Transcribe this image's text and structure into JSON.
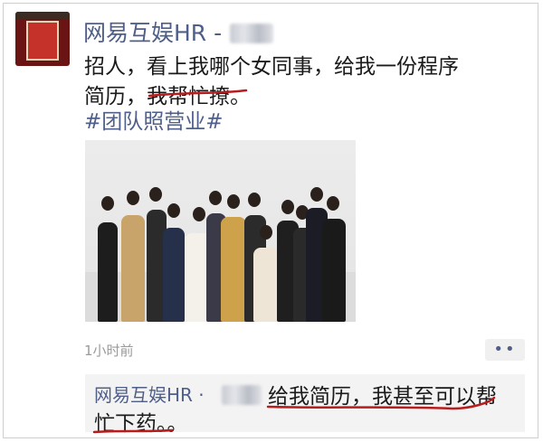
{
  "author": {
    "name": "网易互娱HR -"
  },
  "post": {
    "line1": "招人，看上我哪个女同事，给我一份程序",
    "line2": "简历，我帮忙撩。",
    "hashtag": "#团队照营业#"
  },
  "meta": {
    "time": "1小时前",
    "more": "••"
  },
  "comment": {
    "author": "网易互娱HR ·",
    "text_line1": "给我简历，我甚至可以帮",
    "text_line2": "忙下药。。"
  },
  "colors": {
    "link": "#4f5f8a",
    "annotation": "#b81c1c"
  }
}
